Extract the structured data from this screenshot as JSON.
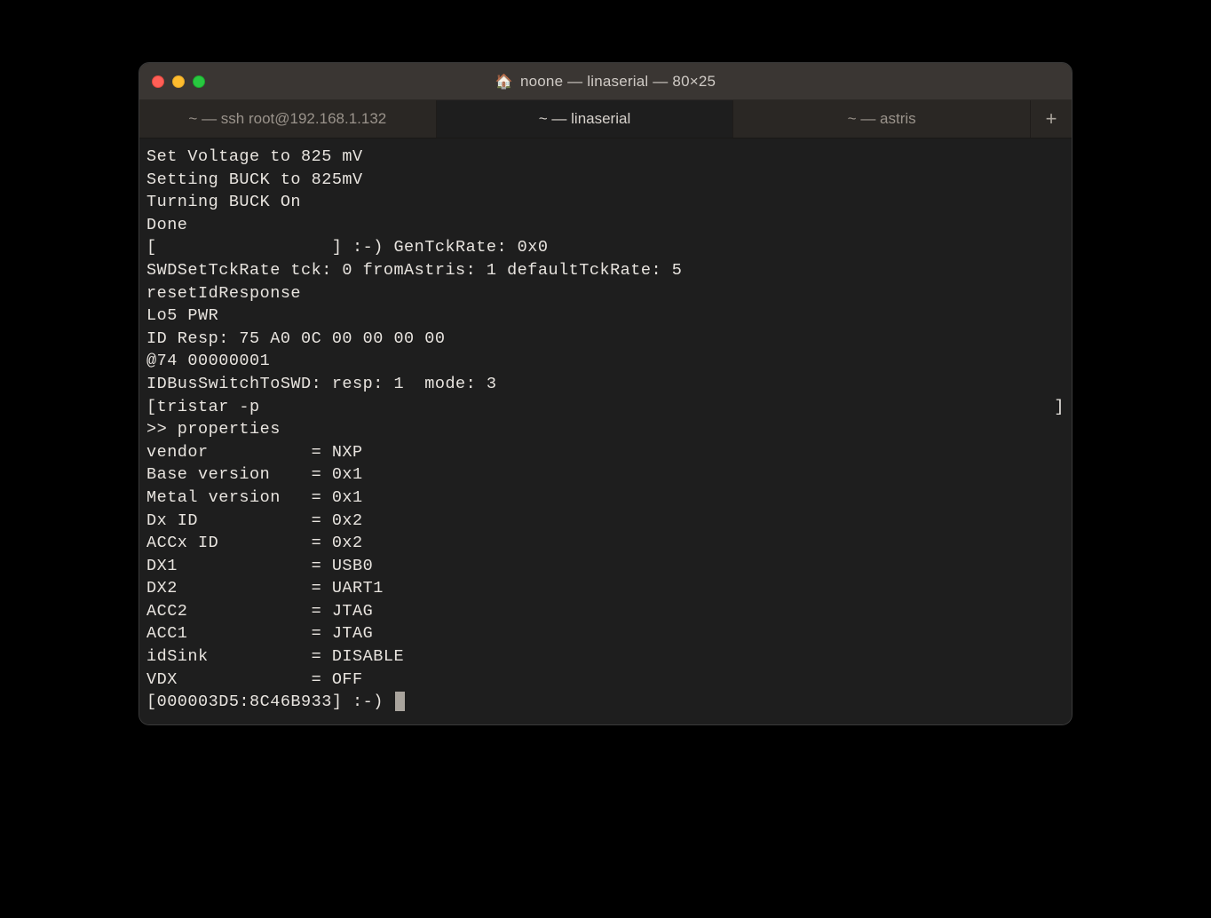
{
  "window": {
    "title": "noone — linaserial — 80×25",
    "home_icon": "🏠"
  },
  "tabs": [
    {
      "label": "~ — ssh root@192.168.1.132",
      "active": false
    },
    {
      "label": "~ — linaserial",
      "active": true
    },
    {
      "label": "~ — astris",
      "active": false
    }
  ],
  "tab_add": "+",
  "terminal": {
    "lines": [
      "Set Voltage to 825 mV",
      "Setting BUCK to 825mV",
      "Turning BUCK On",
      "Done",
      "[                 ] :-) GenTckRate: 0x0",
      "SWDSetTckRate tck: 0 fromAstris: 1 defaultTckRate: 5",
      "resetIdResponse",
      "Lo5 PWR",
      "ID Resp: 75 A0 0C 00 00 00 00",
      "@74 00000001",
      "IDBusSwitchToSWD: resp: 1  mode: 3"
    ],
    "stretch": {
      "left": "[",
      "mid": "tristar -p",
      "right": "]"
    },
    "lines2": [
      ">> properties"
    ],
    "properties": [
      {
        "key": "vendor",
        "val": "NXP"
      },
      {
        "key": "Base version",
        "val": "0x1"
      },
      {
        "key": "Metal version",
        "val": "0x1"
      },
      {
        "key": "Dx ID",
        "val": "0x2"
      },
      {
        "key": "ACCx ID",
        "val": "0x2"
      },
      {
        "key": "DX1",
        "val": "USB0"
      },
      {
        "key": "DX2",
        "val": "UART1"
      },
      {
        "key": "ACC2",
        "val": "JTAG"
      },
      {
        "key": "ACC1",
        "val": "JTAG"
      },
      {
        "key": "idSink",
        "val": "DISABLE"
      },
      {
        "key": "VDX",
        "val": "OFF"
      }
    ],
    "prompt": "[000003D5:8C46B933] :-) "
  }
}
